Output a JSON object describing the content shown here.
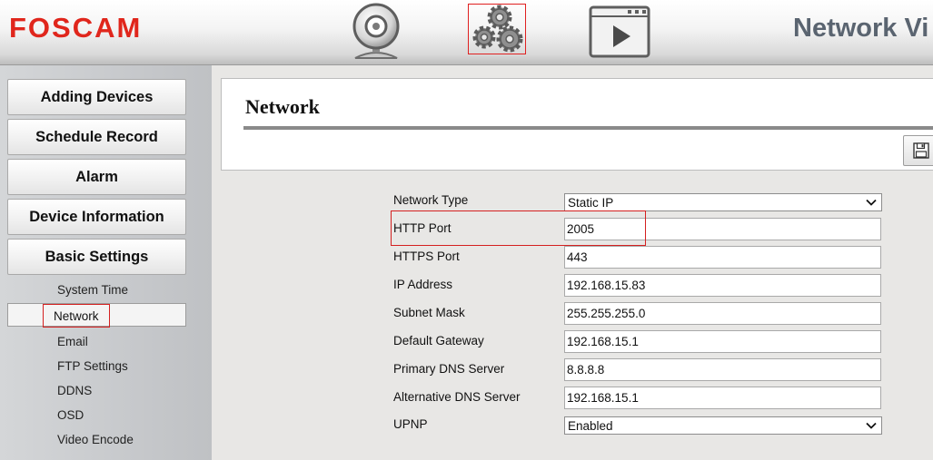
{
  "header": {
    "logo": "FOSCAM",
    "title": "Network Vi",
    "icons": [
      "camera-icon",
      "settings-gears-icon",
      "video-play-icon"
    ]
  },
  "sidebar": {
    "menu": [
      {
        "label": "Adding Devices"
      },
      {
        "label": "Schedule Record"
      },
      {
        "label": "Alarm"
      },
      {
        "label": "Device Information"
      },
      {
        "label": "Basic Settings"
      }
    ],
    "submenu": [
      {
        "label": "System Time"
      },
      {
        "label": "Network",
        "active": true
      },
      {
        "label": "Email"
      },
      {
        "label": "FTP Settings"
      },
      {
        "label": "DDNS"
      },
      {
        "label": "OSD"
      },
      {
        "label": "Video Encode"
      }
    ]
  },
  "content": {
    "title": "Network",
    "save_icon": "floppy-disk-icon",
    "fields": [
      {
        "label": "Network Type",
        "type": "select",
        "value": "Static IP"
      },
      {
        "label": "HTTP Port",
        "type": "input",
        "value": "2005"
      },
      {
        "label": "HTTPS Port",
        "type": "input",
        "value": "443"
      },
      {
        "label": "IP Address",
        "type": "input",
        "value": "192.168.15.83"
      },
      {
        "label": "Subnet Mask",
        "type": "input",
        "value": "255.255.255.0"
      },
      {
        "label": "Default Gateway",
        "type": "input",
        "value": "192.168.15.1"
      },
      {
        "label": "Primary DNS Server",
        "type": "input",
        "value": "8.8.8.8"
      },
      {
        "label": "Alternative DNS Server",
        "type": "input",
        "value": "192.168.15.1"
      },
      {
        "label": "UPNP",
        "type": "select",
        "value": "Enabled"
      }
    ]
  },
  "colors": {
    "logo": "#e0261c",
    "highlight": "#d42020",
    "title_gray": "#5a6470"
  }
}
